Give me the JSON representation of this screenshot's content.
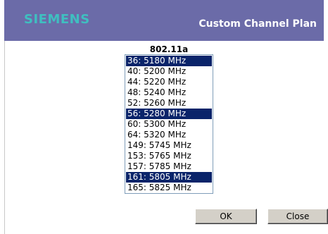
{
  "header": {
    "brand": "SIEMENS",
    "title": "Custom Channel Plan"
  },
  "channel_list": {
    "title": "802.11a",
    "options": [
      {
        "label": "36: 5180 MHz",
        "selected": true
      },
      {
        "label": "40: 5200 MHz",
        "selected": false
      },
      {
        "label": "44: 5220 MHz",
        "selected": false
      },
      {
        "label": "48: 5240 MHz",
        "selected": false
      },
      {
        "label": "52: 5260 MHz",
        "selected": false
      },
      {
        "label": "56: 5280 MHz",
        "selected": true
      },
      {
        "label": "60: 5300 MHz",
        "selected": false
      },
      {
        "label": "64: 5320 MHz",
        "selected": false
      },
      {
        "label": "149: 5745 MHz",
        "selected": false
      },
      {
        "label": "153: 5765 MHz",
        "selected": false
      },
      {
        "label": "157: 5785 MHz",
        "selected": false
      },
      {
        "label": "161: 5805 MHz",
        "selected": true
      },
      {
        "label": "165: 5825 MHz",
        "selected": false
      }
    ]
  },
  "buttons": {
    "ok_label": "OK",
    "close_label": "Close"
  },
  "colors": {
    "header_bg": "#6b6ba8",
    "brand": "#3fbfc0",
    "selection_bg": "#0a246a"
  }
}
